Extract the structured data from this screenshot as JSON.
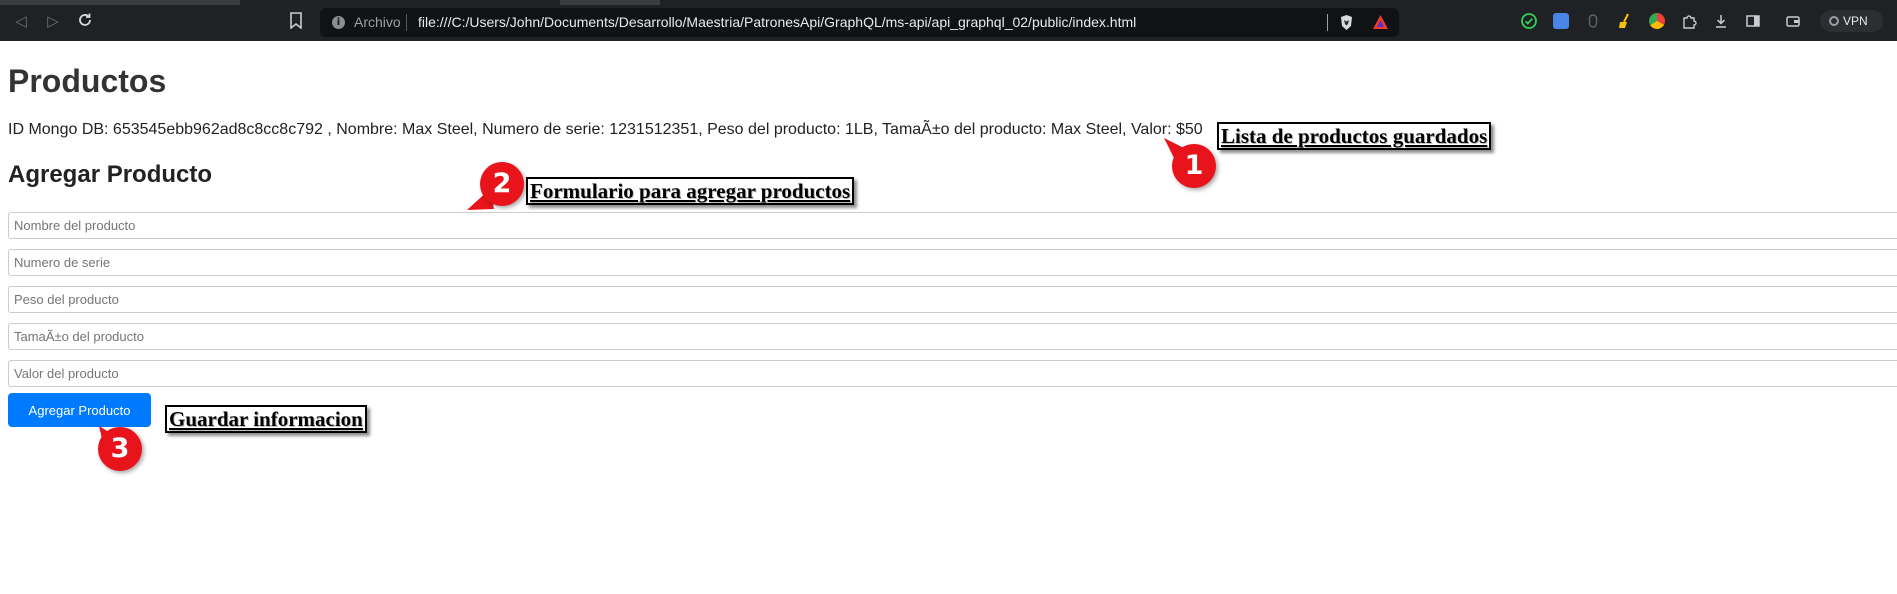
{
  "browser": {
    "url_label": "Archivo",
    "url": "file:///C:/Users/John/Documents/Desarrollo/Maestria/PatronesApi/GraphQL/ms-api/api_graphql_02/public/index.html",
    "vpn_label": "VPN"
  },
  "page": {
    "title": "Productos",
    "product_line": "ID Mongo DB: 653545ebb962ad8c8cc8c792 , Nombre: Max Steel, Numero de serie: 1231512351, Peso del producto: 1LB, TamaÃ±o del producto: Max Steel, Valor: $50",
    "form_title": "Agregar Producto",
    "fields": {
      "nombre": "Nombre del producto",
      "serie": "Numero de serie",
      "peso": "Peso del producto",
      "tamano": "TamaÃ±o del producto",
      "valor": "Valor del producto"
    },
    "submit_label": "Agregar Producto"
  },
  "annotations": {
    "badge_1": "1",
    "note_1": "Lista de productos guardados",
    "badge_2": "2",
    "note_2": "Formulario para agregar productos",
    "badge_3": "3",
    "note_3": "Guardar informacion"
  },
  "colors": {
    "chrome_bg": "#1f2124",
    "button_bg": "#007bff",
    "badge_red": "#e8131b"
  },
  "icons": [
    "back-icon",
    "forward-icon",
    "reload-icon",
    "bookmark-icon",
    "info-icon",
    "brave-shield-icon",
    "brave-rewards-icon",
    "extension-icons",
    "vpn-icon"
  ]
}
